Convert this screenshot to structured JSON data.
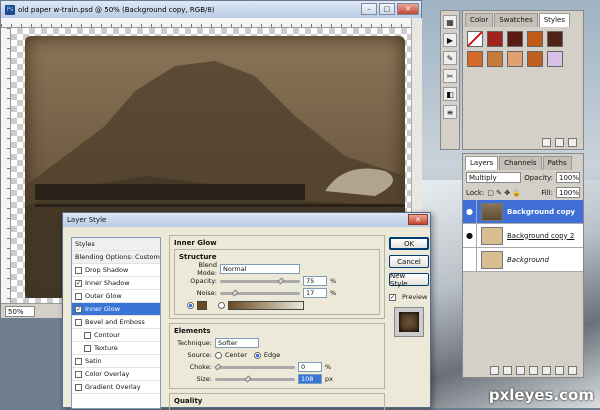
{
  "document": {
    "title": "old paper w-train.psd @ 50% (Background copy, RGB/8)",
    "zoom": "50%"
  },
  "styles_panel": {
    "tabs": [
      "Color",
      "Swatches",
      "Styles"
    ],
    "active_tab": "Styles",
    "swatches": [
      "#ffffff",
      "#a0231d",
      "#5a1c12",
      "#c25a1a",
      "#4d2416",
      "#d46a2a",
      "#c77a3a",
      "#e0a070",
      "#c0601e",
      "#d8c0e8"
    ]
  },
  "layers_panel": {
    "tabs": [
      "Layers",
      "Channels",
      "Paths"
    ],
    "blend_mode": "Multiply",
    "opacity_label": "Opacity:",
    "opacity": "100%",
    "lock_label": "Lock:",
    "fill_label": "Fill:",
    "fill": "100%",
    "layers": [
      {
        "name": "Background copy",
        "active": true
      },
      {
        "name": "Background copy 2",
        "active": false
      },
      {
        "name": "Background",
        "active": false
      }
    ]
  },
  "layer_style": {
    "title": "Layer Style",
    "style_list": [
      {
        "label": "Styles",
        "type": "head"
      },
      {
        "label": "Blending Options: Custom",
        "type": "head"
      },
      {
        "label": "Drop Shadow",
        "checked": false
      },
      {
        "label": "Inner Shadow",
        "checked": true
      },
      {
        "label": "Outer Glow",
        "checked": false
      },
      {
        "label": "Inner Glow",
        "checked": true,
        "active": true
      },
      {
        "label": "Bevel and Emboss",
        "checked": false
      },
      {
        "label": "Contour",
        "checked": false,
        "indent": true
      },
      {
        "label": "Texture",
        "checked": false,
        "indent": true
      },
      {
        "label": "Satin",
        "checked": false
      },
      {
        "label": "Color Overlay",
        "checked": false
      },
      {
        "label": "Gradient Overlay",
        "checked": false
      }
    ],
    "section_title": "Inner Glow",
    "structure": {
      "title": "Structure",
      "blend_mode_label": "Blend Mode:",
      "blend_mode": "Normal",
      "opacity_label": "Opacity:",
      "opacity": "75",
      "noise_label": "Noise:",
      "noise": "17",
      "percent": "%"
    },
    "elements": {
      "title": "Elements",
      "technique_label": "Technique:",
      "technique": "Softer",
      "source_label": "Source:",
      "center_label": "Center",
      "edge_label": "Edge",
      "choke_label": "Choke:",
      "choke": "0",
      "size_label": "Size:",
      "size": "108",
      "percent": "%",
      "px": "px"
    },
    "quality_title": "Quality",
    "buttons": {
      "ok": "OK",
      "cancel": "Cancel",
      "new_style": "New Style...",
      "preview": "Preview"
    }
  },
  "watermark": "pxleyes.com"
}
